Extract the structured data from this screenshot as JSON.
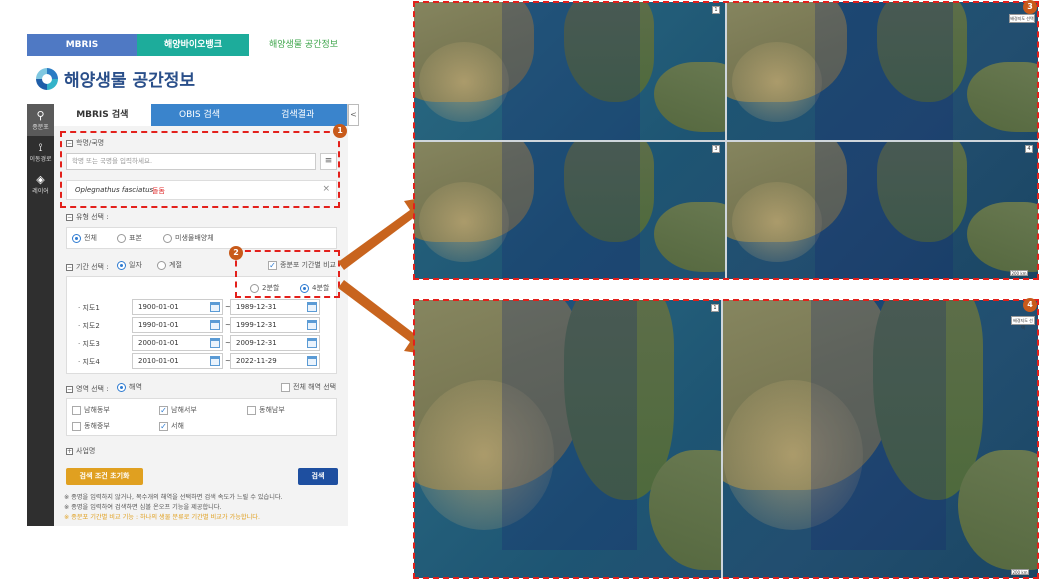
{
  "topnav": {
    "tab1": "MBRIS",
    "tab2": "해양바이오뱅크",
    "tab3": "해양생물 공간정보"
  },
  "logo": {
    "title": "해양생물 공간정보"
  },
  "sidebar": {
    "items": [
      {
        "label": "종분포",
        "icon": "map-pin-icon"
      },
      {
        "label": "이동경로",
        "icon": "route-icon"
      },
      {
        "label": "레이어",
        "icon": "layers-icon"
      }
    ]
  },
  "tabs": [
    "MBRIS 검색",
    "OBIS 검색",
    "검색결과"
  ],
  "collapse_label": "<",
  "search": {
    "section_label": "학명/국명",
    "placeholder": "학명 또는 국명을 입력하세요.",
    "selected_sci": "Oplegnathus fasciatus",
    "selected_kr": "돌돔",
    "clear": "×"
  },
  "type_select": {
    "label": "유형 선택 :",
    "options": [
      "전체",
      "표본",
      "미생물배양체"
    ],
    "selected": "전체"
  },
  "period": {
    "label": "기간 선택 :",
    "options": [
      "일자",
      "계절"
    ],
    "selected": "일자",
    "compare_label": "종분포 기간별 비교",
    "compare_checked": true,
    "split_options": [
      "2분할",
      "4분할"
    ],
    "split_selected": "4분할",
    "maps": [
      {
        "label": "· 지도1",
        "from": "1900-01-01",
        "to": "1989-12-31"
      },
      {
        "label": "· 지도2",
        "from": "1990-01-01",
        "to": "1999-12-31"
      },
      {
        "label": "· 지도3",
        "from": "2000-01-01",
        "to": "2009-12-31"
      },
      {
        "label": "· 지도4",
        "from": "2010-01-01",
        "to": "2022-11-29"
      }
    ],
    "tilde": "~"
  },
  "region": {
    "label": "영역 선택 :",
    "option": "해역",
    "all_label": "전체 해역 선택",
    "seas": [
      {
        "name": "남해동부",
        "checked": false
      },
      {
        "name": "남해서부",
        "checked": true
      },
      {
        "name": "동해남부",
        "checked": false
      },
      {
        "name": "동해중부",
        "checked": false
      },
      {
        "name": "서해",
        "checked": true
      }
    ]
  },
  "business": {
    "label": "사업명"
  },
  "buttons": {
    "reset": "검색 조건 초기화",
    "search": "검색"
  },
  "notes": [
    "※ 종명을 입력하지 않거나, 복수개의 해역을 선택하면 검색 속도가 느릴 수 있습니다.",
    "※ 종명을 입력하여 검색하면 심볼 온오프 기능을 제공합니다.",
    "※ 종분포 기간별 비교 기능 : 하나의 생물 분류로 기간별 비교가 가능합니다."
  ],
  "markers": [
    "1",
    "2",
    "3",
    "4"
  ],
  "map_top": {
    "badges": [
      "1",
      "3",
      "4"
    ],
    "button": "배경지도 선택",
    "scale": "200 km"
  },
  "map_bottom": {
    "badges": [
      "1"
    ],
    "button": "배경지도 선택",
    "scale": "200 km"
  },
  "colors": {
    "accent": "#e3201b",
    "marker": "#c85a1a",
    "arrow": "#c8641e",
    "tab_blue": "#3a84cc",
    "reset": "#e0a020",
    "search_btn": "#1e4fa0"
  }
}
